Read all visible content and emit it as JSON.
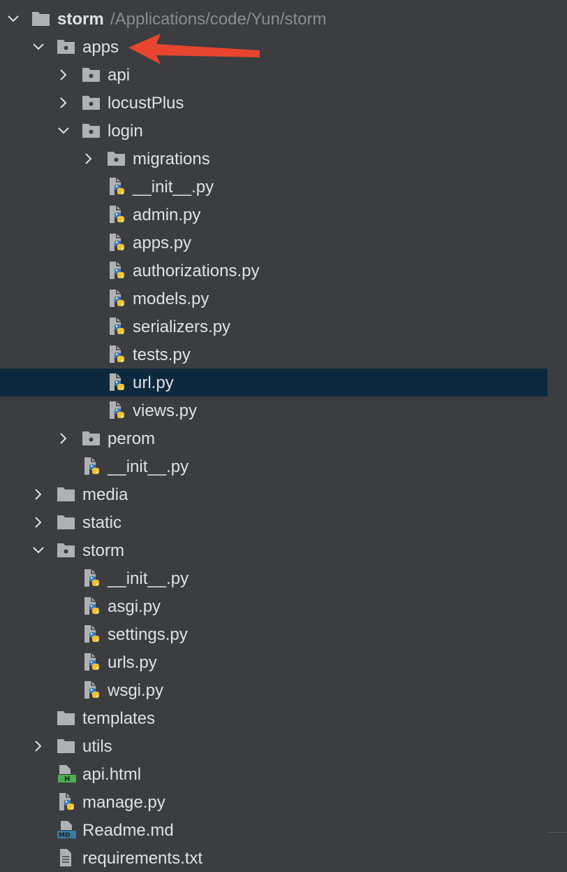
{
  "colors": {
    "background": "#3b3d40",
    "selection": "#0d293e",
    "text": "#dfe1e5",
    "path_text": "#8a8d91",
    "folder": "#afb1b3",
    "python_blue": "#3e7ab8",
    "python_yellow": "#f2c230",
    "html_badge": "#4caf50",
    "md_badge": "#3a7ba3",
    "annotation_arrow": "#e8452f"
  },
  "tree": [
    {
      "label": "storm",
      "path": "/Applications/code/Yun/storm",
      "depth": 0,
      "chevron": "expanded",
      "icon": "folder-icon",
      "bold": true
    },
    {
      "label": "apps",
      "depth": 1,
      "chevron": "expanded",
      "icon": "module-folder-icon"
    },
    {
      "label": "api",
      "depth": 2,
      "chevron": "collapsed",
      "icon": "module-folder-icon"
    },
    {
      "label": "locustPlus",
      "depth": 2,
      "chevron": "collapsed",
      "icon": "module-folder-icon"
    },
    {
      "label": "login",
      "depth": 2,
      "chevron": "expanded",
      "icon": "module-folder-icon"
    },
    {
      "label": "migrations",
      "depth": 3,
      "chevron": "collapsed",
      "icon": "module-folder-icon"
    },
    {
      "label": "__init__.py",
      "depth": 3,
      "icon": "python-file-icon"
    },
    {
      "label": "admin.py",
      "depth": 3,
      "icon": "python-file-icon"
    },
    {
      "label": "apps.py",
      "depth": 3,
      "icon": "python-file-icon"
    },
    {
      "label": "authorizations.py",
      "depth": 3,
      "icon": "python-file-icon"
    },
    {
      "label": "models.py",
      "depth": 3,
      "icon": "python-file-icon"
    },
    {
      "label": "serializers.py",
      "depth": 3,
      "icon": "python-file-icon"
    },
    {
      "label": "tests.py",
      "depth": 3,
      "icon": "python-file-icon"
    },
    {
      "label": "url.py",
      "depth": 3,
      "icon": "python-file-icon",
      "selected": true
    },
    {
      "label": "views.py",
      "depth": 3,
      "icon": "python-file-icon"
    },
    {
      "label": "perom",
      "depth": 2,
      "chevron": "collapsed",
      "icon": "module-folder-icon"
    },
    {
      "label": "__init__.py",
      "depth": 2,
      "icon": "python-file-icon"
    },
    {
      "label": "media",
      "depth": 1,
      "chevron": "collapsed",
      "icon": "folder-icon"
    },
    {
      "label": "static",
      "depth": 1,
      "chevron": "collapsed",
      "icon": "folder-icon"
    },
    {
      "label": "storm",
      "depth": 1,
      "chevron": "expanded",
      "icon": "module-folder-icon"
    },
    {
      "label": "__init__.py",
      "depth": 2,
      "icon": "python-file-icon"
    },
    {
      "label": "asgi.py",
      "depth": 2,
      "icon": "python-file-icon"
    },
    {
      "label": "settings.py",
      "depth": 2,
      "icon": "python-file-icon"
    },
    {
      "label": "urls.py",
      "depth": 2,
      "icon": "python-file-icon"
    },
    {
      "label": "wsgi.py",
      "depth": 2,
      "icon": "python-file-icon"
    },
    {
      "label": "templates",
      "depth": 1,
      "icon": "folder-icon"
    },
    {
      "label": "utils",
      "depth": 1,
      "chevron": "collapsed",
      "icon": "folder-icon"
    },
    {
      "label": "api.html",
      "depth": 1,
      "icon": "html-file-icon"
    },
    {
      "label": "manage.py",
      "depth": 1,
      "icon": "python-file-icon"
    },
    {
      "label": "Readme.md",
      "depth": 1,
      "icon": "markdown-file-icon"
    },
    {
      "label": "requirements.txt",
      "depth": 1,
      "icon": "text-file-icon"
    }
  ]
}
